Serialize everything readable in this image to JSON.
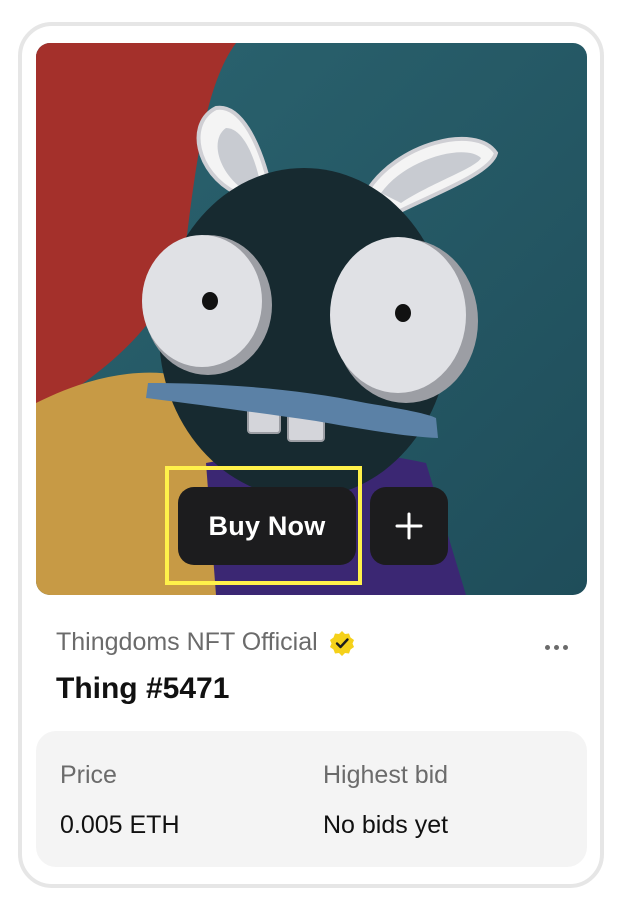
{
  "card": {
    "artwork_alt": "Thing #5471 artwork",
    "buy_now_label": "Buy Now",
    "add_icon": "plus-icon",
    "collection_name": "Thingdoms NFT Official",
    "verified_icon": "verified-badge-icon",
    "more_icon": "more-horizontal-icon",
    "item_name": "Thing #5471"
  },
  "pricing": {
    "price_label": "Price",
    "price_value": "0.005 ETH",
    "highest_bid_label": "Highest bid",
    "highest_bid_value": "No bids yet"
  },
  "colors": {
    "button_bg": "#1c1c1e",
    "highlight": "#fff14a",
    "verified_badge": "#f5d11a",
    "panel_bg": "#f4f4f4"
  }
}
